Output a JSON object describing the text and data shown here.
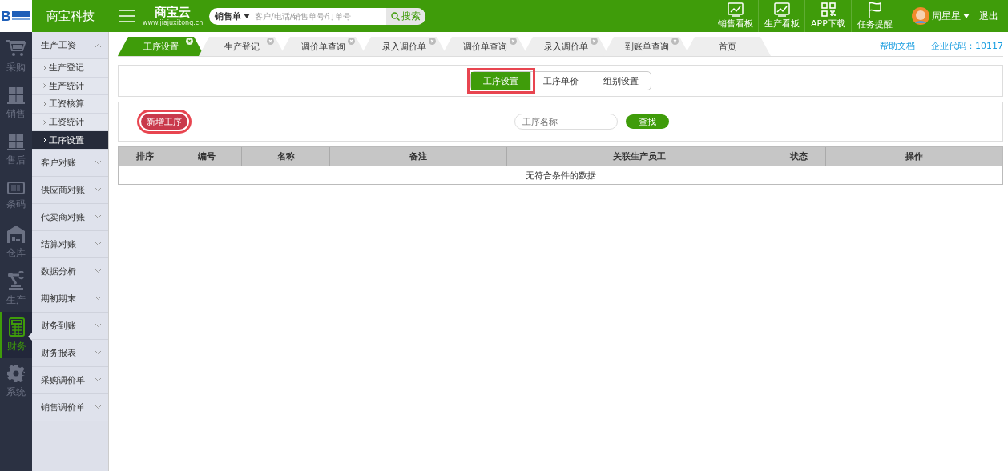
{
  "logo": {
    "name": "商宝云",
    "url": "www.jiajuxitong.cn"
  },
  "brand": "商宝科技",
  "search": {
    "type": "销售单",
    "placeholder": "客户/电话/销售单号/订单号",
    "button": "搜索"
  },
  "toolbar": [
    {
      "kind": "chart",
      "label": "销售看板"
    },
    {
      "kind": "chart",
      "label": "生产看板"
    },
    {
      "kind": "qr",
      "label": "APP下载"
    },
    {
      "kind": "flag",
      "label": "任务提醒"
    }
  ],
  "user": {
    "name": "周星星",
    "logout": "退出"
  },
  "rail": [
    {
      "kind": "cart",
      "label": "采购",
      "selected": false
    },
    {
      "kind": "boxes",
      "label": "销售",
      "selected": false
    },
    {
      "kind": "boxes",
      "label": "售后",
      "selected": false
    },
    {
      "kind": "barcode",
      "label": "条码",
      "selected": false
    },
    {
      "kind": "house",
      "label": "仓库",
      "selected": false
    },
    {
      "kind": "robot",
      "label": "生产",
      "selected": false
    },
    {
      "kind": "calc",
      "label": "财务",
      "selected": true
    },
    {
      "kind": "gear",
      "label": "系统",
      "selected": false
    }
  ],
  "sidebar": [
    {
      "label": "生产工资",
      "expanded": true,
      "children": [
        {
          "label": "生产登记",
          "selected": false
        },
        {
          "label": "生产统计",
          "selected": false
        },
        {
          "label": "工资核算",
          "selected": false
        },
        {
          "label": "工资统计",
          "selected": false
        },
        {
          "label": "工序设置",
          "selected": true
        }
      ]
    },
    {
      "label": "客户对账",
      "expanded": false
    },
    {
      "label": "供应商对账",
      "expanded": false
    },
    {
      "label": "代卖商对账",
      "expanded": false
    },
    {
      "label": "结算对账",
      "expanded": false
    },
    {
      "label": "数据分析",
      "expanded": false
    },
    {
      "label": "期初期末",
      "expanded": false
    },
    {
      "label": "财务到账",
      "expanded": false
    },
    {
      "label": "财务报表",
      "expanded": false
    },
    {
      "label": "采购调价单",
      "expanded": false
    },
    {
      "label": "销售调价单",
      "expanded": false
    }
  ],
  "tabs": [
    {
      "label": "工序设置",
      "selected": true
    },
    {
      "label": "生产登记",
      "selected": false
    },
    {
      "label": "调价单查询",
      "selected": false
    },
    {
      "label": "录入调价单",
      "selected": false
    },
    {
      "label": "调价单查询",
      "selected": false
    },
    {
      "label": "录入调价单",
      "selected": false
    },
    {
      "label": "到账单查询",
      "selected": false
    },
    {
      "label": "首页",
      "selected": false,
      "closable": false
    }
  ],
  "help_link": "帮助文档",
  "company_code": "企业代码：10117",
  "subtabs": [
    {
      "label": "工序设置",
      "selected": true,
      "highlighted": true
    },
    {
      "label": "工序单价",
      "selected": false,
      "highlighted": false
    },
    {
      "label": "组别设置",
      "selected": false,
      "highlighted": false
    }
  ],
  "add_button": {
    "label": "新增工序",
    "highlighted": true
  },
  "filter": {
    "placeholder": "工序名称",
    "button": "查找"
  },
  "table": {
    "columns": [
      "排序",
      "编号",
      "名称",
      "备注",
      "关联生产员工",
      "状态",
      "操作"
    ],
    "empty_message": "无符合条件的数据"
  }
}
